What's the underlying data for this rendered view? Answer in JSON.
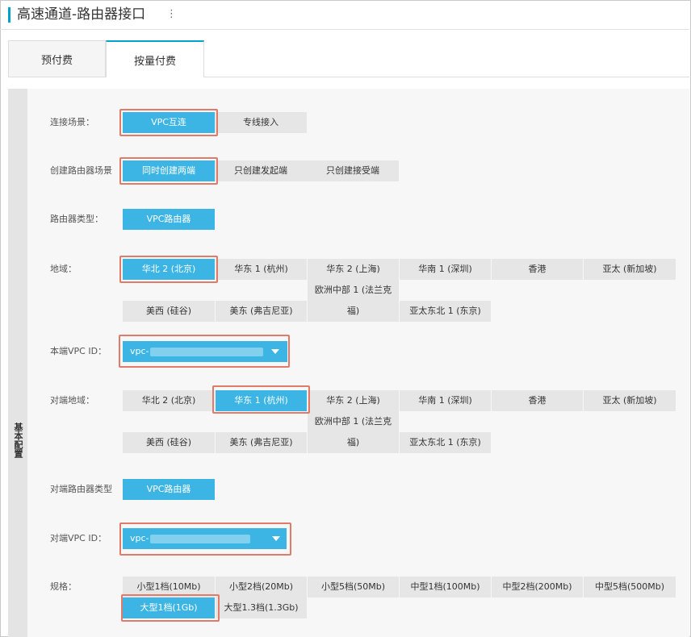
{
  "header": {
    "title": "高速通道-路由器接口",
    "menu_icon": "⋮"
  },
  "tabs": [
    {
      "label": "预付费"
    },
    {
      "label": "按量付费"
    }
  ],
  "side_label": "基本配置",
  "connect_scene": {
    "label": "连接场景：",
    "options": [
      "VPC互连",
      "专线接入"
    ]
  },
  "create_scene": {
    "label": "创建路由器场景",
    "options": [
      "同时创建两端",
      "只创建发起端",
      "只创建接受端"
    ]
  },
  "router_type": {
    "label": "路由器类型：",
    "value": "VPC路由器"
  },
  "region": {
    "label": "地域：",
    "options": [
      "华北 2 (北京)",
      "华东 1 (杭州)",
      "华东 2 (上海)",
      "华南 1 (深圳)",
      "香港",
      "亚太 (新加坡)",
      "美西 (硅谷)",
      "美东 (弗吉尼亚)",
      "欧洲中部 1 (法兰克福)",
      "亚太东北 1 (东京)"
    ]
  },
  "local_vpc": {
    "label": "本端VPC ID：",
    "prefix": "vpc-"
  },
  "peer_region": {
    "label": "对端地域：",
    "options": [
      "华北 2 (北京)",
      "华东 1 (杭州)",
      "华东 2 (上海)",
      "华南 1 (深圳)",
      "香港",
      "亚太 (新加坡)",
      "美西 (硅谷)",
      "美东 (弗吉尼亚)",
      "欧洲中部 1 (法兰克福)",
      "亚太东北 1 (东京)"
    ]
  },
  "peer_router_type": {
    "label": "对端路由器类型",
    "value": "VPC路由器"
  },
  "peer_vpc": {
    "label": "对端VPC ID：",
    "prefix": "vpc-"
  },
  "spec": {
    "label": "规格：",
    "options": [
      "小型1档(10Mb)",
      "小型2档(20Mb)",
      "小型5档(50Mb)",
      "中型1档(100Mb)",
      "中型2档(200Mb)",
      "中型5档(500Mb)",
      "大型1档(1Gb)",
      "大型1.3档(1.3Gb)"
    ]
  },
  "colors": {
    "accent": "#00a2ca",
    "selected": "#3cb5e5",
    "highlight": "#e07b6a"
  }
}
